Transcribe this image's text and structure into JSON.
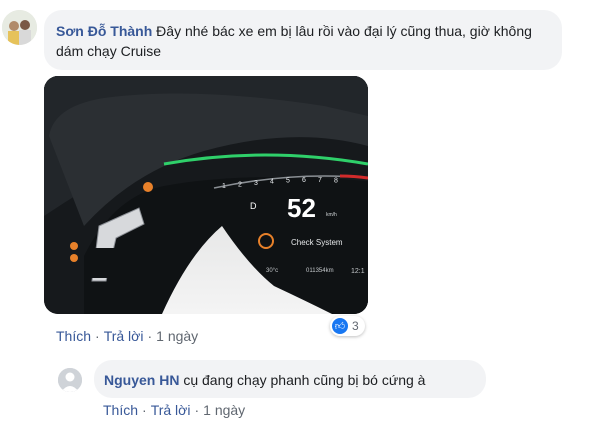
{
  "comment": {
    "author": "Sơn Đỗ Thành",
    "text": "Đây nhé bác xe em bị lâu rồi vào đại lý cũng thua, giờ không dám chạy Cruise",
    "photo": {
      "speed": "52",
      "speed_unit": "km/h",
      "gear": "D",
      "message": "Check System",
      "temperature": "30°c",
      "odometer": "011354km",
      "clock": "12:1",
      "tach_labels": [
        "1",
        "2",
        "3",
        "4",
        "5",
        "6",
        "7",
        "8"
      ]
    },
    "reaction_count": "3",
    "like_label": "Thích",
    "reply_label": "Trả lời",
    "time": "1 ngày"
  },
  "reply": {
    "author": "Nguyen HN",
    "text": "cụ đang chạy phanh cũng bị bó cứng à",
    "like_label": "Thích",
    "reply_label": "Trả lời",
    "time": "1 ngày"
  },
  "colors": {
    "author_link": "#385898",
    "bubble_bg": "#f2f3f5",
    "like_blue": "#1877f2",
    "dash_green": "#3bd16a",
    "warning_amber": "#e8812a"
  },
  "icons": [
    "like-icon",
    "thumbs-up-icon",
    "avatar-icon"
  ]
}
